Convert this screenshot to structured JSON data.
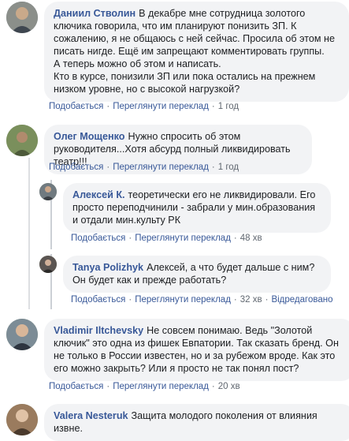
{
  "comments": [
    {
      "author": "Даниил Стволин",
      "text": "В декабре мне сотрудница золотого ключика говорила, что им планируют понизить ЗП. К сожалению, я не общаюсь с ней сейчас. Просила об этом не писать нигде. Ещё им запрещают комментировать группы.\nА теперь можно об этом и написать.\nКто в курсе, понизили ЗП или пока остались на прежнем низком уровне, но с высокой нагрузкой?",
      "like": "Подобається",
      "translate": "Переглянути переклад",
      "time": "1 год"
    },
    {
      "author": "Олег Мощенко",
      "text": "Нужно спросить об этом руководителя...Хотя абсурд полный ликвидировать театр!!!",
      "like": "Подобається",
      "translate": "Переглянути переклад",
      "time": "1 год"
    },
    {
      "author": "Алексей К.",
      "text": "теоретически его не ликвидировали. Его просто переподчинили - забрали у мин.образования и отдали мин.культу РК",
      "like": "Подобається",
      "translate": "Переглянути переклад",
      "time": "48 хв"
    },
    {
      "author": "Tanya Polizhyk",
      "text": "Алексей, а что будет дальше с ним? Он будет как и прежде работать?",
      "like": "Подобається",
      "translate": "Переглянути переклад",
      "time": "32 хв",
      "edited": "Відредаговано"
    },
    {
      "author": "Vladimir Iltchevsky",
      "text": "Не совсем понимаю. Ведь \"Золотой ключик\" это одна из фишек Евпатории. Так сказать бренд. Он не только в России известен, но и за рубежом вроде. Как это его можно закрыть? Или я просто не так понял пост?",
      "like": "Подобається",
      "translate": "Переглянути переклад",
      "time": "20 хв"
    },
    {
      "author": "Valera Nesteruk",
      "text": "Защита молодого поколения от влияния извне."
    }
  ]
}
